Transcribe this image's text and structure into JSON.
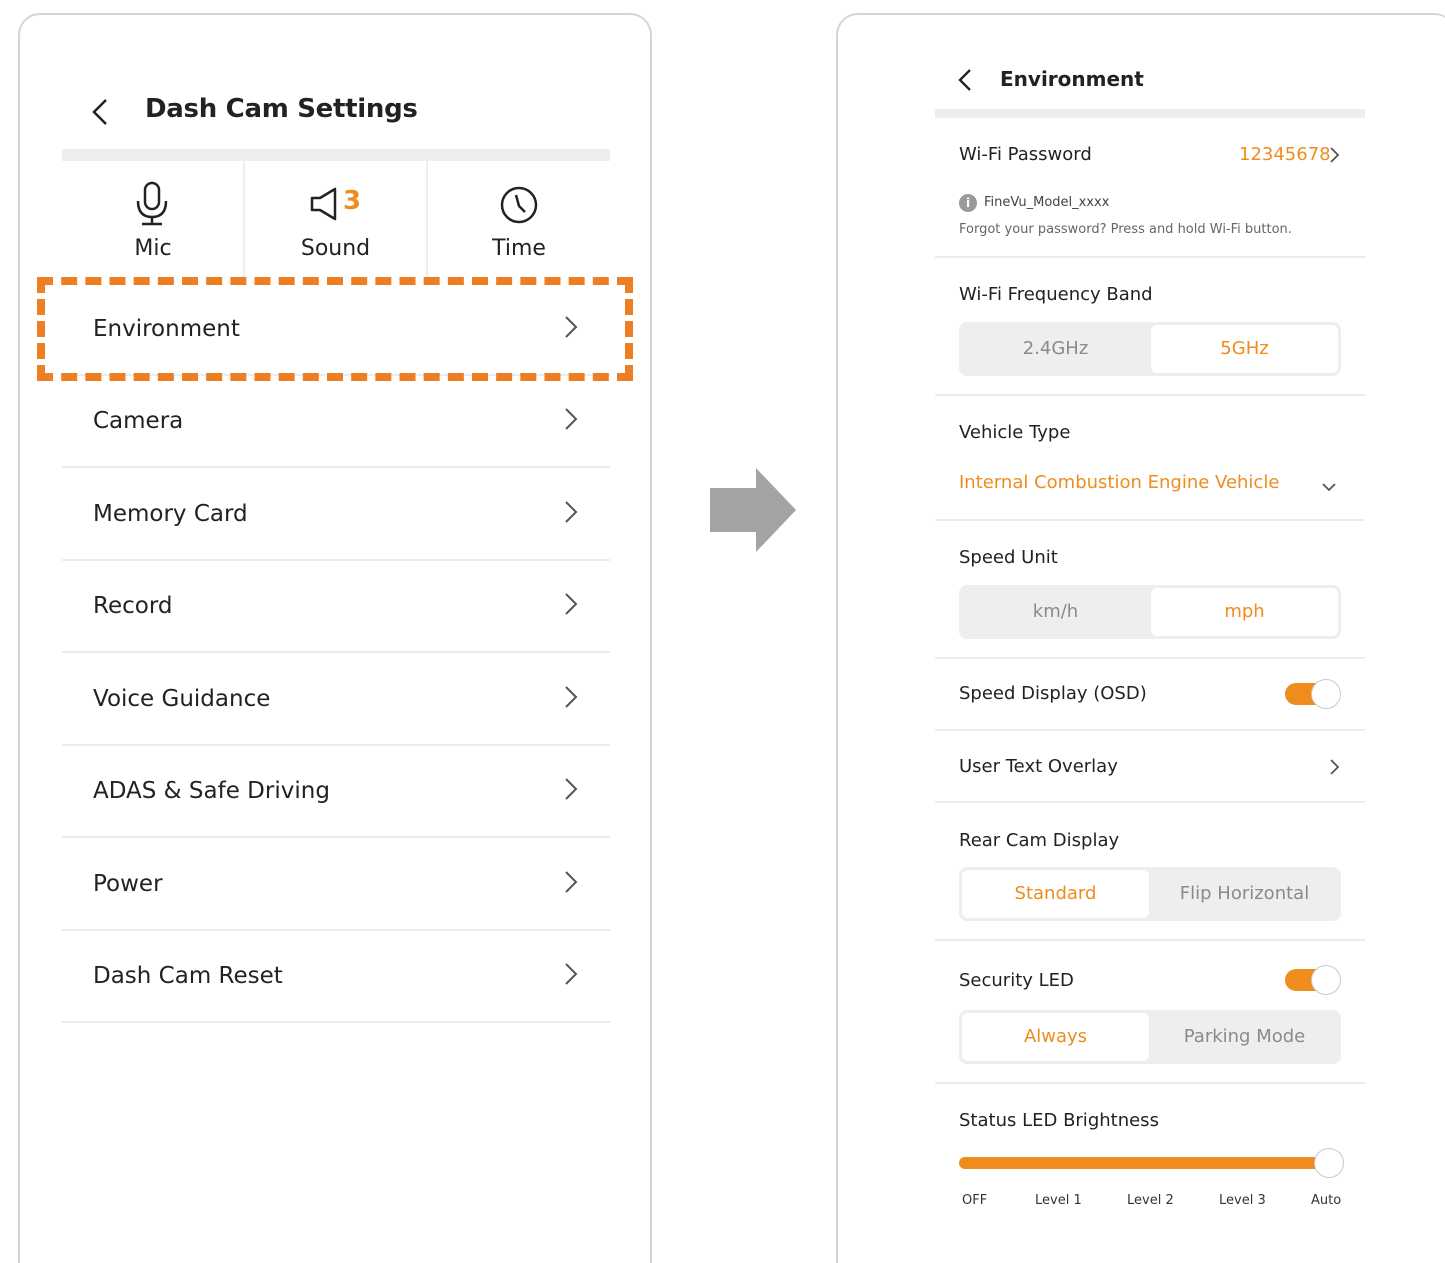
{
  "left": {
    "title": "Dash Cam Settings",
    "quick": [
      {
        "label": "Mic",
        "icon": "mic-icon"
      },
      {
        "label": "Sound",
        "icon": "speaker-icon",
        "badge": "3"
      },
      {
        "label": "Time",
        "icon": "clock-icon"
      }
    ],
    "menu": [
      "Environment",
      "Camera",
      "Memory Card",
      "Record",
      "Voice Guidance",
      "ADAS & Safe Driving",
      "Power",
      "Dash Cam Reset"
    ]
  },
  "right": {
    "title": "Environment",
    "wifi_password_label": "Wi-Fi Password",
    "wifi_password_value": "12345678",
    "wifi_ssid": "FineVu_Model_xxxx",
    "wifi_hint": "Forgot your password? Press and hold Wi-Fi button.",
    "freq_label": "Wi-Fi Frequency Band",
    "freq_options": [
      "2.4GHz",
      "5GHz"
    ],
    "vehicle_label": "Vehicle Type",
    "vehicle_value": "Internal Combustion Engine Vehicle",
    "speed_unit_label": "Speed Unit",
    "speed_unit_options": [
      "km/h",
      "mph"
    ],
    "speed_display_label": "Speed Display (OSD)",
    "user_text_label": "User Text Overlay",
    "rear_cam_label": "Rear Cam Display",
    "rear_cam_options": [
      "Standard",
      "Flip Horizontal"
    ],
    "security_led_label": "Security LED",
    "security_led_options": [
      "Always",
      "Parking Mode"
    ],
    "status_led_label": "Status LED Brightness",
    "status_led_levels": [
      "OFF",
      "Level 1",
      "Level 2",
      "Level 3",
      "Auto"
    ],
    "status_led_value": "Auto"
  },
  "colors": {
    "accent": "#ef8c1e",
    "highlight": "#ef7d22"
  }
}
